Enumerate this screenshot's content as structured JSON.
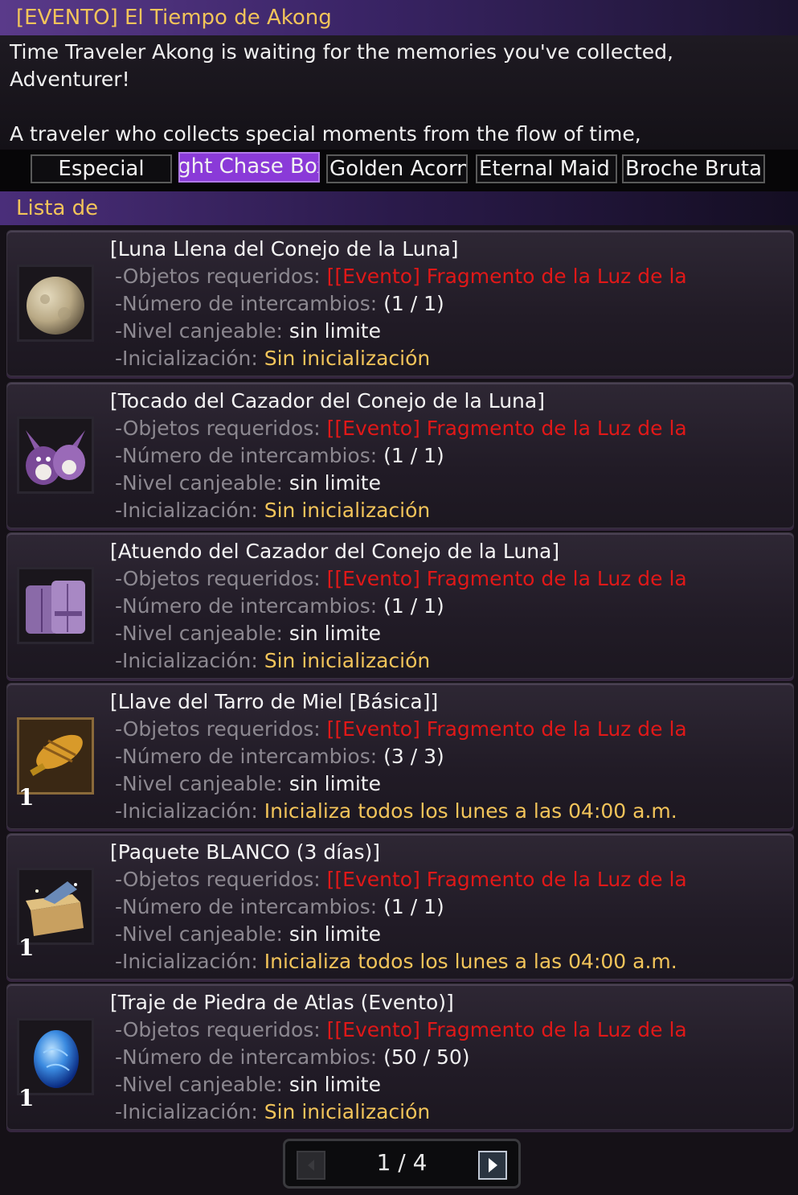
{
  "window": {
    "title": "[EVENTO] El Tiempo de Akong"
  },
  "intro": {
    "line1": "Time Traveler Akong is waiting for the memories you've collected,",
    "line2": "Adventurer!",
    "line3": "A traveler who collects special moments from the flow of time,"
  },
  "tabs": [
    {
      "label": "Especial",
      "active": false
    },
    {
      "label": "Moonlight Chase Box",
      "active": true
    },
    {
      "label": "Golden Acorn",
      "active": false
    },
    {
      "label": "Eternal Maid",
      "active": false
    },
    {
      "label": "Broche Brutal",
      "active": false
    }
  ],
  "list_header": "Lista de",
  "labels": {
    "required": "-Objetos requeridos: ",
    "exchanges": "-Número de intercambios: ",
    "level": "-Nivel canjeable: ",
    "reset": "-Inicialización: "
  },
  "items": [
    {
      "name": "[Luna Llena del Conejo de la Luna]",
      "required": "[[Evento] Fragmento de la Luz de la",
      "exchanges": "(1 / 1)",
      "level": "sin limite",
      "reset": "Sin inicialización",
      "qty": "",
      "icon": "moon-icon"
    },
    {
      "name": "[Tocado del Cazador del Conejo de la Luna]",
      "required": "[[Evento] Fragmento de la Luz de la",
      "exchanges": "(1 / 1)",
      "level": "sin limite",
      "reset": "Sin inicialización",
      "qty": "",
      "icon": "bunny-hood-icon"
    },
    {
      "name": "[Atuendo del Cazador del Conejo de la Luna]",
      "required": "[[Evento] Fragmento de la Luz de la",
      "exchanges": "(1 / 1)",
      "level": "sin limite",
      "reset": "Sin inicialización",
      "qty": "",
      "icon": "outfit-icon"
    },
    {
      "name": "[Llave del Tarro de Miel [Básica]]",
      "required": "[[Evento] Fragmento de la Luz de la",
      "exchanges": "(3 / 3)",
      "level": "sin limite",
      "reset": "Inicializa todos los lunes a las 04:00 a.m.",
      "qty": "1",
      "icon": "honey-key-icon"
    },
    {
      "name": "[Paquete BLANCO (3 días)]",
      "required": "[[Evento] Fragmento de la Luz de la",
      "exchanges": "(1 / 1)",
      "level": "sin limite",
      "reset": "Inicializa todos los lunes a las 04:00 a.m.",
      "qty": "1",
      "icon": "package-box-icon"
    },
    {
      "name": "[Traje de Piedra de Atlas (Evento)]",
      "required": "[[Evento] Fragmento de la Luz de la",
      "exchanges": "(50 / 50)",
      "level": "sin limite",
      "reset": "Sin inicialización",
      "qty": "1",
      "icon": "atlas-stone-icon"
    }
  ],
  "pager": {
    "text": "1 / 4"
  },
  "colors": {
    "title_gold": "#f2c45a",
    "required_red": "#e01818",
    "active_tab": "#8a3ad8"
  }
}
